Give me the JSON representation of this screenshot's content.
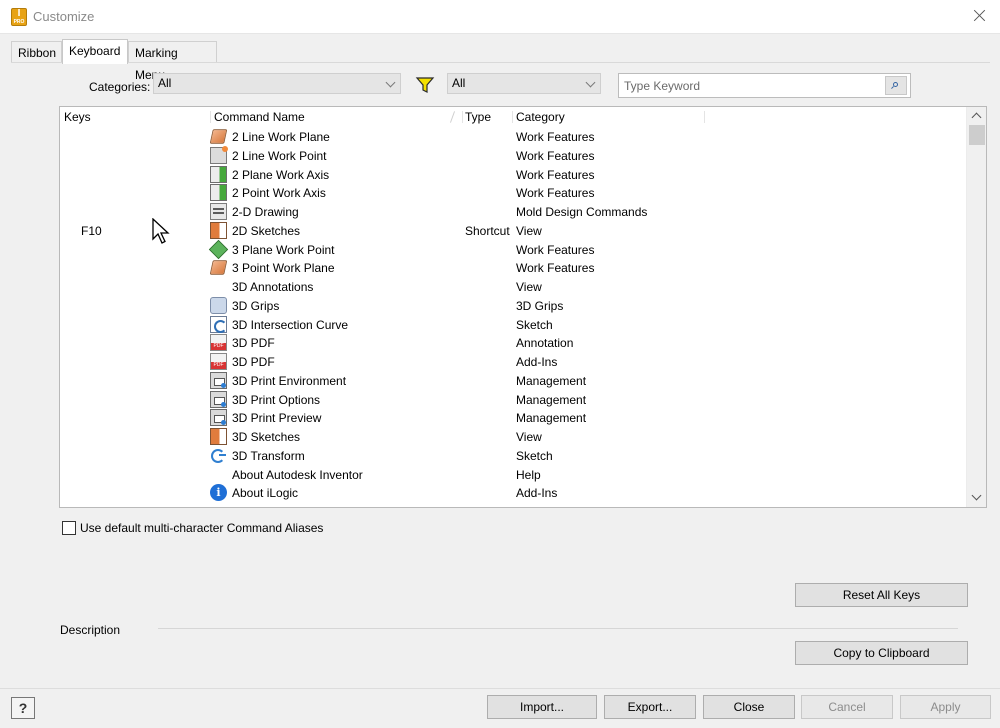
{
  "window": {
    "title": "Customize",
    "app_icon_letter": "I",
    "app_icon_sub": "PRO"
  },
  "tabs": [
    {
      "label": "Ribbon",
      "active": false
    },
    {
      "label": "Keyboard",
      "active": true
    },
    {
      "label": "Marking Menu",
      "active": false
    }
  ],
  "filters": {
    "categories_label": "Categories:",
    "categories_value": "All",
    "filter_value": "All",
    "search_placeholder": "Type Keyword"
  },
  "grid": {
    "columns": {
      "keys": "Keys",
      "command": "Command Name",
      "type": "Type",
      "category": "Category"
    },
    "rows": [
      {
        "key": "",
        "icon": "work-plane-icon",
        "command": "2 Line Work Plane",
        "type": "",
        "category": "Work Features"
      },
      {
        "key": "",
        "icon": "work-point-icon",
        "command": "2 Line Work Point",
        "type": "",
        "category": "Work Features"
      },
      {
        "key": "",
        "icon": "work-axis-icon",
        "command": "2 Plane Work Axis",
        "type": "",
        "category": "Work Features"
      },
      {
        "key": "",
        "icon": "work-axis-icon",
        "command": "2 Point Work Axis",
        "type": "",
        "category": "Work Features"
      },
      {
        "key": "",
        "icon": "drawing-icon",
        "command": "2-D Drawing",
        "type": "",
        "category": "Mold Design Commands"
      },
      {
        "key": "F10",
        "icon": "sketch-icon",
        "command": "2D Sketches",
        "type": "Shortcut",
        "category": "View"
      },
      {
        "key": "",
        "icon": "work-point-3plane-icon",
        "command": "3 Plane Work Point",
        "type": "",
        "category": "Work Features"
      },
      {
        "key": "",
        "icon": "work-plane-icon",
        "command": "3 Point Work Plane",
        "type": "",
        "category": "Work Features"
      },
      {
        "key": "",
        "icon": "",
        "command": "3D Annotations",
        "type": "",
        "category": "View"
      },
      {
        "key": "",
        "icon": "grips-icon",
        "command": "3D Grips",
        "type": "",
        "category": "3D Grips"
      },
      {
        "key": "",
        "icon": "intersection-curve-icon",
        "command": "3D Intersection Curve",
        "type": "",
        "category": "Sketch"
      },
      {
        "key": "",
        "icon": "pdf-icon",
        "command": "3D PDF",
        "type": "",
        "category": "Annotation"
      },
      {
        "key": "",
        "icon": "pdf-icon",
        "command": "3D PDF",
        "type": "",
        "category": "Add-Ins"
      },
      {
        "key": "",
        "icon": "print-icon",
        "command": "3D Print Environment",
        "type": "",
        "category": "Management"
      },
      {
        "key": "",
        "icon": "print-icon",
        "command": "3D Print Options",
        "type": "",
        "category": "Management"
      },
      {
        "key": "",
        "icon": "print-icon",
        "command": "3D Print Preview",
        "type": "",
        "category": "Management"
      },
      {
        "key": "",
        "icon": "sketch-icon",
        "command": "3D Sketches",
        "type": "",
        "category": "View"
      },
      {
        "key": "",
        "icon": "transform-icon",
        "command": "3D Transform",
        "type": "",
        "category": "Sketch"
      },
      {
        "key": "",
        "icon": "",
        "command": "About Autodesk Inventor",
        "type": "",
        "category": "Help"
      },
      {
        "key": "",
        "icon": "info-icon",
        "command": "About iLogic",
        "type": "",
        "category": "Add-Ins"
      }
    ]
  },
  "options": {
    "default_aliases_label": "Use default multi-character Command Aliases",
    "default_aliases_checked": false
  },
  "buttons": {
    "reset_all_keys": "Reset All Keys",
    "copy_to_clipboard": "Copy to Clipboard",
    "import": "Import...",
    "export": "Export...",
    "close": "Close",
    "cancel": "Cancel",
    "apply": "Apply",
    "help": "?"
  },
  "description": {
    "label": "Description"
  },
  "colors": {
    "filter_funnel": "#f5e100",
    "window_bg": "#f0f0f0",
    "disabled_text": "#8c8c8c"
  }
}
